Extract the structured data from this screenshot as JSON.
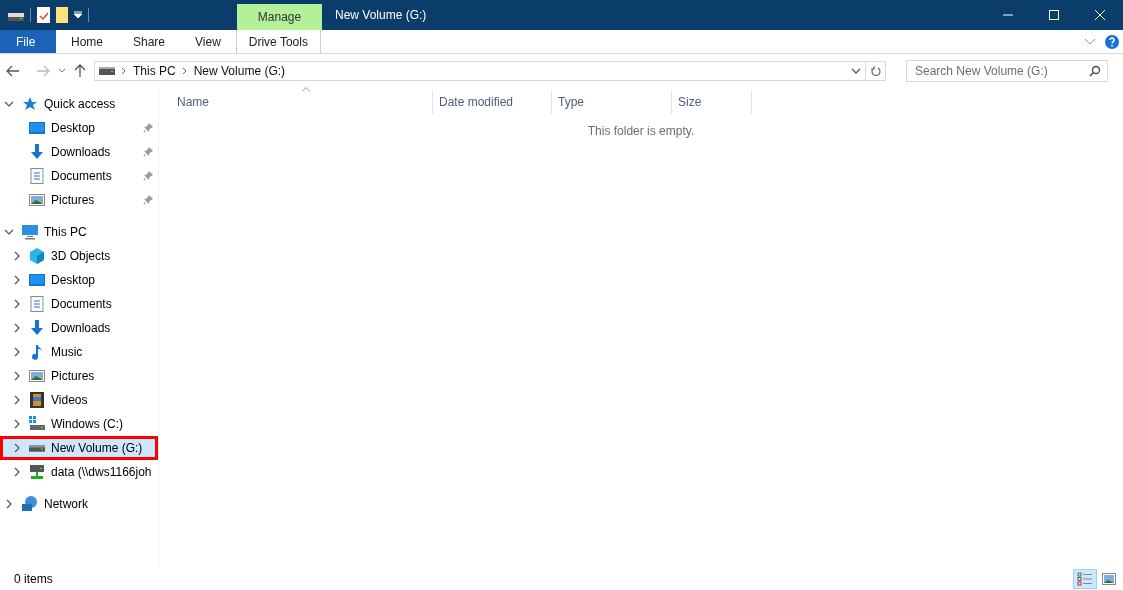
{
  "window": {
    "title": "New Volume (G:)"
  },
  "context_tab": {
    "group": "Manage",
    "label": "Drive Tools"
  },
  "ribbon_tabs": [
    {
      "label": "File",
      "kind": "file"
    },
    {
      "label": "Home",
      "kind": "tab"
    },
    {
      "label": "Share",
      "kind": "tab"
    },
    {
      "label": "View",
      "kind": "tab"
    }
  ],
  "address": {
    "crumbs": [
      "This PC",
      "New Volume (G:)"
    ]
  },
  "search": {
    "placeholder": "Search New Volume (G:)"
  },
  "nav": [
    {
      "label": "Quick access",
      "kind": "star",
      "expanded": true,
      "children": [
        {
          "label": "Desktop",
          "kind": "desktop",
          "pinned": true
        },
        {
          "label": "Downloads",
          "kind": "download",
          "pinned": true
        },
        {
          "label": "Documents",
          "kind": "document",
          "pinned": true
        },
        {
          "label": "Pictures",
          "kind": "pictures",
          "pinned": true
        }
      ]
    },
    {
      "label": "This PC",
      "kind": "pc",
      "expanded": true,
      "children": [
        {
          "label": "3D Objects",
          "kind": "cube",
          "selected": false,
          "highlighted": false
        },
        {
          "label": "Desktop",
          "kind": "desktop",
          "selected": false,
          "highlighted": false
        },
        {
          "label": "Documents",
          "kind": "document",
          "selected": false,
          "highlighted": false
        },
        {
          "label": "Downloads",
          "kind": "download",
          "selected": false,
          "highlighted": false
        },
        {
          "label": "Music",
          "kind": "music",
          "selected": false,
          "highlighted": false
        },
        {
          "label": "Pictures",
          "kind": "pictures",
          "selected": false,
          "highlighted": false
        },
        {
          "label": "Videos",
          "kind": "video",
          "selected": false,
          "highlighted": false
        },
        {
          "label": "Windows (C:)",
          "kind": "windrive",
          "selected": false,
          "highlighted": false
        },
        {
          "label": "New Volume (G:)",
          "kind": "drive",
          "selected": true,
          "highlighted": true
        },
        {
          "label": "data (\\\\dws1166joh",
          "kind": "netdrive",
          "selected": false,
          "highlighted": false
        }
      ]
    },
    {
      "label": "Network",
      "kind": "network",
      "expanded": false
    }
  ],
  "columns": [
    {
      "label": "Name",
      "sorted": true
    },
    {
      "label": "Date modified",
      "sorted": false
    },
    {
      "label": "Type",
      "sorted": false
    },
    {
      "label": "Size",
      "sorted": false
    }
  ],
  "empty_message": "This folder is empty.",
  "status_bar": {
    "count": "0 items",
    "view_buttons": [
      {
        "kind": "details",
        "selected": true
      },
      {
        "kind": "thumbnails",
        "selected": false
      }
    ]
  }
}
